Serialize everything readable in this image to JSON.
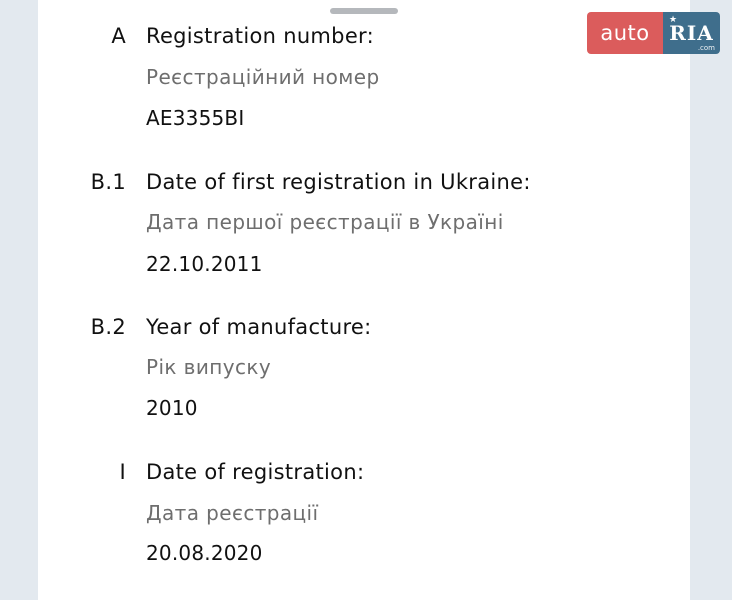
{
  "logo": {
    "auto_text": "auto",
    "ria_text": "RIA",
    "dotcom_text": ".com",
    "auto_color": "#db5c5c",
    "ria_color": "#3f6e8c"
  },
  "fields": [
    {
      "code": "A",
      "title": "Registration number:",
      "subtitle": "Реєстраційний номер",
      "value": "AE3355BI"
    },
    {
      "code": "B.1",
      "title": "Date of first registration in Ukraine:",
      "subtitle": "Дата першої реєстрації в Україні",
      "value": "22.10.2011"
    },
    {
      "code": "B.2",
      "title": "Year of manufacture:",
      "subtitle": "Рік випуску",
      "value": "2010"
    },
    {
      "code": "I",
      "title": "Date of registration:",
      "subtitle": "Дата реєстрації",
      "value": "20.08.2020"
    }
  ]
}
